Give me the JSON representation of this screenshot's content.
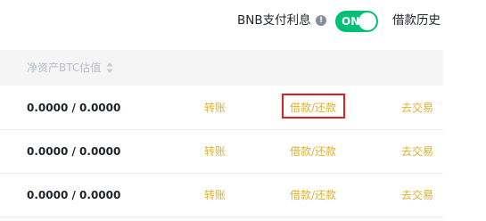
{
  "header": {
    "bnb_interest_label": "BNB支付利息",
    "info_icon_glyph": "!",
    "toggle_label": "ON",
    "toggle_state": "on",
    "toggle_color": "#02c076",
    "history_link": "借款历史"
  },
  "table": {
    "column_title": "净资产BTC估值",
    "sort_icon": "sort-icon",
    "action_color": "#e0b12e",
    "rows": [
      {
        "value": "0.0000 / 0.0000",
        "transfer": "转账",
        "borrow_repay": "借款/还款",
        "trade": "去交易"
      },
      {
        "value": "0.0000 / 0.0000",
        "transfer": "转账",
        "borrow_repay": "借款/还款",
        "trade": "去交易"
      },
      {
        "value": "0.0000 / 0.0000",
        "transfer": "转账",
        "borrow_repay": "借款/还款",
        "trade": "去交易"
      }
    ]
  },
  "annotation": {
    "highlight_color": "#e02020",
    "highlighted_element": "借款/还款"
  }
}
